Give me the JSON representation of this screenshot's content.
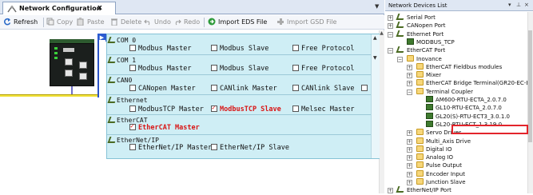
{
  "window": {
    "tab_label": "Network Configuration",
    "tab_close": "x"
  },
  "toolbar": {
    "refresh": "Refresh",
    "copy": "Copy",
    "paste": "Paste",
    "delete": "Delete",
    "undo": "Undo",
    "redo": "Redo",
    "import_eds": "Import EDS File",
    "import_gsd": "Import GSD File"
  },
  "popup": {
    "ports": [
      {
        "title": "COM 0",
        "options": [
          {
            "label": "Modbus Master",
            "checked": false
          },
          {
            "label": "Modbus Slave",
            "checked": false
          },
          {
            "label": "Free Protocol",
            "checked": false
          }
        ]
      },
      {
        "title": "COM 1",
        "options": [
          {
            "label": "Modbus Master",
            "checked": false
          },
          {
            "label": "Modbus Slave",
            "checked": false
          },
          {
            "label": "Free Protocol",
            "checked": false
          }
        ]
      },
      {
        "title": "CAN0",
        "options": [
          {
            "label": "CANopen Master",
            "checked": false
          },
          {
            "label": "CANlink Master",
            "checked": false
          },
          {
            "label": "CANlink Slave",
            "checked": false
          }
        ]
      },
      {
        "title": "Ethernet",
        "options": [
          {
            "label": "ModbusTCP Master",
            "checked": false
          },
          {
            "label": "ModbusTCP Slave",
            "checked": true
          },
          {
            "label": "Melsec Master",
            "checked": false
          }
        ]
      },
      {
        "title": "EtherCAT",
        "options": [
          {
            "label": "EtherCAT Master",
            "checked": true
          }
        ]
      },
      {
        "title": "EtherNet/IP",
        "options": [
          {
            "label": "EtherNet/IP Master",
            "checked": false
          },
          {
            "label": "EtherNet/IP Slave",
            "checked": false
          }
        ]
      }
    ]
  },
  "devices": {
    "title": "Network Devices List",
    "tree": [
      "Serial Port",
      "CANopen Port",
      "Ethernet Port",
      "MODBUS_TCP",
      "EtherCAT Port",
      "Inovance",
      "EtherCAT Fieldbus modules",
      "Mixer",
      "EtherCAT Bridge Terminal(GR20-EC-EC)",
      "Terminal Coupler",
      "AM600-RTU-ECTA_2.0.7.0",
      "GL10-RTU-ECTA_2.0.7.0",
      "GL20(S)-RTU-ECT3_3.0.1.0",
      "GL20-RTU-ECT_1.3.19.0",
      "Servo Drives",
      "Multi_Axis Drive",
      "Digital IO",
      "Analog IO",
      "Pulse Output",
      "Encoder Input",
      "Junction Slave",
      "EtherNet/IP Port"
    ]
  },
  "colors": {
    "accent": "#2b53c6",
    "popup_bg": "#cfeef5",
    "highlight": "#e3242b",
    "selected_text": "#d91515"
  }
}
